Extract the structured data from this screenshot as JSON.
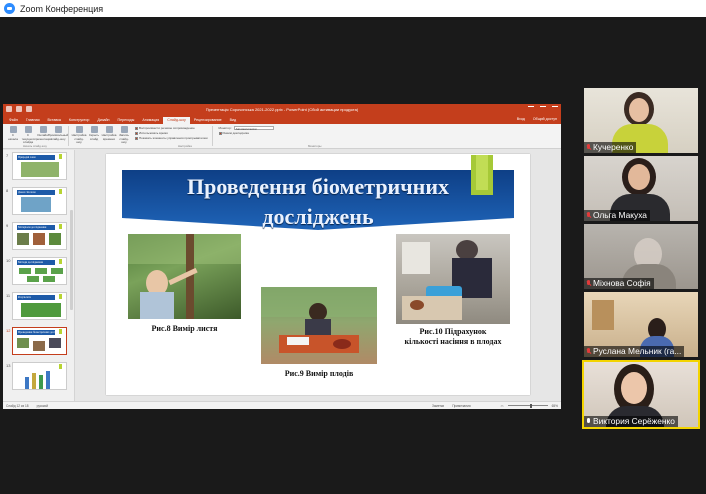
{
  "zoom": {
    "window_title": "Zoom Конференция"
  },
  "powerpoint": {
    "doc_title": "Презентація Сорочинська 2021-2022.pptx - PowerPoint (Сбой активации продукта)",
    "tabs": [
      {
        "label": "Файл"
      },
      {
        "label": "Главная"
      },
      {
        "label": "Вставка"
      },
      {
        "label": "Конструктор"
      },
      {
        "label": "Дизайн"
      },
      {
        "label": "Переходы"
      },
      {
        "label": "Анимация"
      },
      {
        "label": "Слайд-шоу"
      },
      {
        "label": "Рецензирование"
      },
      {
        "label": "Вид"
      }
    ],
    "active_tab_index": 7,
    "tabs_right": {
      "signin": "Вход",
      "share": "Общий доступ"
    },
    "ribbon": {
      "buttons": [
        {
          "label": "С начала"
        },
        {
          "label": "С текущего слайда"
        },
        {
          "label": "Онлайн-презентация"
        },
        {
          "label": "Произвольный слайд-шоу"
        },
        {
          "label": "Настройка слайд-шоу"
        },
        {
          "label": "Скрыть слайд"
        },
        {
          "label": "Настройка времени"
        },
        {
          "label": "Запись слайд-шоу"
        }
      ],
      "checks": [
        {
          "label": "Воспроизвести речевое сопровождение",
          "checked": true
        },
        {
          "label": "Использовать время",
          "checked": true
        },
        {
          "label": "Показать элементы управления проигрывателем",
          "checked": true
        }
      ],
      "monitor_label": "Монитор:",
      "monitor_value": "Автоматически",
      "presenter_check": "Режим докладчика",
      "group_start": "Начать слайд-шоу",
      "group_setup": "Настройка",
      "group_monitors": "Мониторы"
    },
    "thumbnails": [
      {
        "num": "7",
        "title": "Природні зони"
      },
      {
        "num": "8",
        "title": "Доказ гіпотези"
      },
      {
        "num": "9",
        "title": "Матеріали дослідження"
      },
      {
        "num": "10",
        "title": "Методи дослідження"
      },
      {
        "num": "11",
        "title": "Результати"
      },
      {
        "num": "12",
        "title": "Проведення біометричних досліджень"
      },
      {
        "num": "13",
        "title": ""
      }
    ],
    "selected_thumb_index": 5,
    "slide": {
      "title_line1": "Проведення біометричних",
      "title_line2": "досліджень",
      "captions": {
        "fig8": "Рис.8 Вимір листя",
        "fig9": "Рис.9 Вимір плодів",
        "fig10_line1": "Рис.10 Підрахунок",
        "fig10_line2": "кількості насіння в плодах"
      }
    },
    "statusbar": {
      "slide_info": "Слайд 12 из 18",
      "language": "русский",
      "notes": "Заметки",
      "comments": "Примечания",
      "zoom": "65%"
    }
  },
  "participants": [
    {
      "name": "Кучеренко",
      "mic": "muted"
    },
    {
      "name": "Ольга Макуха",
      "mic": "muted"
    },
    {
      "name": "Міхнова Софія",
      "mic": "muted"
    },
    {
      "name": "Руслана Мельник (га...",
      "mic": "muted"
    },
    {
      "name": "Виктория Серёженко",
      "mic": "active"
    }
  ],
  "colors": {
    "ppt_accent": "#c43e1c",
    "slide_banner": "#1f64b8",
    "slide_green": "#a6c937",
    "active_speaker": "#f3d400",
    "zoom_blue": "#2d8cff"
  }
}
